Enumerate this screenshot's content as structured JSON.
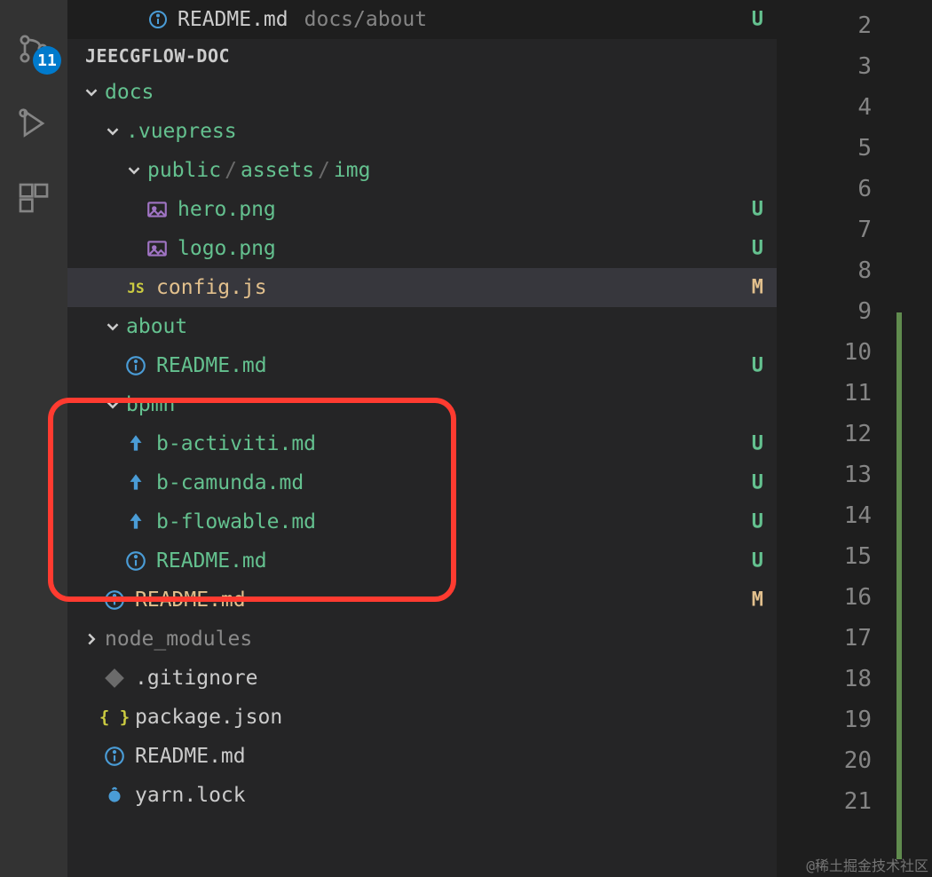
{
  "activity_bar": {
    "badge_count": 11
  },
  "open_editor": {
    "file": "README.md",
    "path": "docs/about",
    "status": "U"
  },
  "project": "JEECGFLOW-DOC",
  "tree": [
    {
      "kind": "folder",
      "label": "docs",
      "indent": 16,
      "status": "dot-amber",
      "open": true,
      "git": "added"
    },
    {
      "kind": "folder",
      "label": ".vuepress",
      "indent": 40,
      "status": "dot-amber",
      "open": true,
      "git": "added"
    },
    {
      "kind": "folder-path",
      "parts": [
        "public",
        "assets",
        "img"
      ],
      "indent": 64,
      "status": "dot-green",
      "open": true,
      "git": "added"
    },
    {
      "kind": "file",
      "label": "hero.png",
      "icon": "image",
      "indent": 88,
      "status": "U",
      "git": "untracked"
    },
    {
      "kind": "file",
      "label": "logo.png",
      "icon": "image",
      "indent": 88,
      "status": "U",
      "git": "untracked"
    },
    {
      "kind": "file",
      "label": "config.js",
      "icon": "js",
      "indent": 64,
      "status": "M",
      "git": "modified",
      "selected": true
    },
    {
      "kind": "folder",
      "label": "about",
      "indent": 40,
      "status": "dot-green",
      "open": true,
      "git": "added"
    },
    {
      "kind": "file",
      "label": "README.md",
      "icon": "info",
      "indent": 64,
      "status": "U",
      "git": "untracked"
    },
    {
      "kind": "folder",
      "label": "bpmn",
      "indent": 40,
      "status": "dot-green",
      "open": true,
      "git": "added"
    },
    {
      "kind": "file",
      "label": "b-activiti.md",
      "icon": "md",
      "indent": 64,
      "status": "U",
      "git": "untracked"
    },
    {
      "kind": "file",
      "label": "b-camunda.md",
      "icon": "md",
      "indent": 64,
      "status": "U",
      "git": "untracked"
    },
    {
      "kind": "file",
      "label": "b-flowable.md",
      "icon": "md",
      "indent": 64,
      "status": "U",
      "git": "untracked"
    },
    {
      "kind": "file",
      "label": "README.md",
      "icon": "info",
      "indent": 64,
      "status": "U",
      "git": "untracked"
    },
    {
      "kind": "file",
      "label": "README.md",
      "icon": "info",
      "indent": 40,
      "status": "M",
      "git": "modified"
    },
    {
      "kind": "folder",
      "label": "node_modules",
      "indent": 16,
      "open": false
    },
    {
      "kind": "file",
      "label": ".gitignore",
      "icon": "git",
      "indent": 40
    },
    {
      "kind": "file",
      "label": "package.json",
      "icon": "json",
      "indent": 40
    },
    {
      "kind": "file",
      "label": "README.md",
      "icon": "info",
      "indent": 40
    },
    {
      "kind": "file",
      "label": "yarn.lock",
      "icon": "yarn",
      "indent": 40
    }
  ],
  "line_numbers": [
    2,
    3,
    4,
    5,
    6,
    7,
    8,
    9,
    10,
    11,
    12,
    13,
    14,
    15,
    16,
    17,
    18,
    19,
    20,
    21
  ],
  "watermark": "@稀土掘金技术社区"
}
